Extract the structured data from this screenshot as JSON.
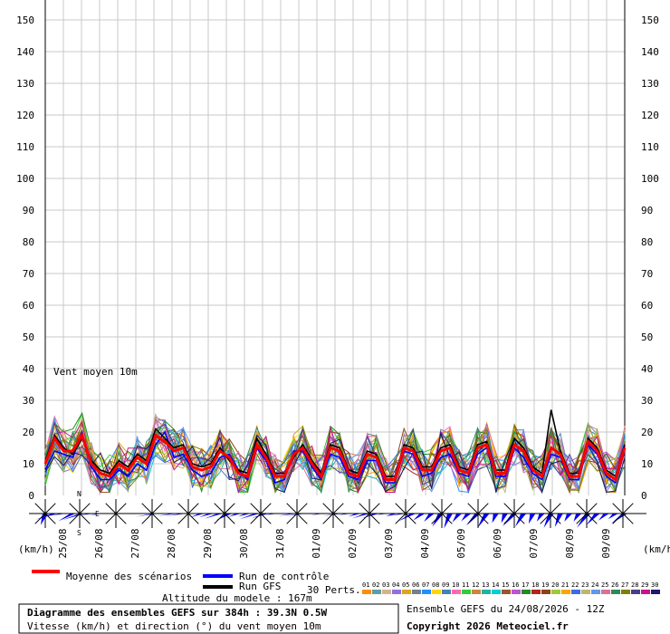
{
  "chart_data": {
    "type": "line",
    "title": "Diagramme des ensembles GEFS sur 384h : 39.3N 0.5W",
    "subtitle": "Vitesse (km/h) et direction (°) du vent moyen 10m",
    "panel_label": "Vent moyen 10m",
    "ylim": [
      0,
      150
    ],
    "yticks": [
      0,
      10,
      20,
      30,
      40,
      50,
      60,
      70,
      80,
      90,
      100,
      110,
      120,
      130,
      140,
      150
    ],
    "x_dates": [
      "25/08",
      "26/08",
      "27/08",
      "28/08",
      "29/08",
      "30/08",
      "31/08",
      "01/09",
      "02/09",
      "03/09",
      "04/09",
      "05/09",
      "06/09",
      "07/09",
      "08/09",
      "09/09"
    ],
    "unit_left": "(km/h)",
    "unit_right": "(km/h)",
    "grid": true,
    "series": [
      {
        "name": "Moyenne des scénarios",
        "color": "#ff0000",
        "values": [
          10,
          18,
          14,
          14,
          19,
          10,
          7,
          6,
          10,
          8,
          12,
          10,
          19,
          17,
          14,
          15,
          9,
          8,
          9,
          14,
          12,
          7,
          6,
          16,
          12,
          6,
          6,
          13,
          15,
          10,
          6,
          15,
          14,
          7,
          6,
          13,
          12,
          5,
          5,
          15,
          14,
          8,
          8,
          14,
          15,
          8,
          7,
          15,
          16,
          7,
          7,
          16,
          14,
          8,
          6,
          15,
          13,
          6,
          6,
          17,
          14,
          7,
          5,
          15
        ]
      },
      {
        "name": "Run de contrôle",
        "color": "#0000ff",
        "values": [
          8,
          14,
          13,
          12,
          20,
          9,
          5,
          5,
          8,
          6,
          10,
          8,
          16,
          20,
          12,
          13,
          8,
          6,
          7,
          12,
          13,
          8,
          5,
          15,
          11,
          4,
          5,
          14,
          14,
          9,
          5,
          13,
          12,
          6,
          5,
          11,
          11,
          4,
          4,
          14,
          13,
          6,
          7,
          12,
          13,
          7,
          6,
          13,
          15,
          6,
          6,
          15,
          12,
          7,
          5,
          13,
          12,
          5,
          5,
          16,
          13,
          6,
          4,
          14
        ]
      },
      {
        "name": "Run GFS",
        "color": "#000000",
        "values": [
          11,
          19,
          15,
          13,
          18,
          11,
          8,
          7,
          11,
          9,
          13,
          11,
          21,
          18,
          15,
          16,
          10,
          9,
          10,
          15,
          11,
          8,
          7,
          18,
          13,
          7,
          7,
          12,
          16,
          11,
          7,
          16,
          15,
          8,
          7,
          14,
          13,
          6,
          6,
          16,
          15,
          9,
          9,
          15,
          16,
          9,
          8,
          16,
          17,
          8,
          8,
          18,
          15,
          9,
          7,
          27,
          14,
          7,
          7,
          18,
          15,
          8,
          6,
          16
        ]
      }
    ],
    "perturbation_count_label": "30 Perts.",
    "perturbation_numbers": [
      "01",
      "02",
      "03",
      "04",
      "05",
      "06",
      "07",
      "08",
      "09",
      "10",
      "11",
      "12",
      "13",
      "14",
      "15",
      "16",
      "17",
      "18",
      "19",
      "20",
      "21",
      "22",
      "23",
      "24",
      "25",
      "26",
      "27",
      "28",
      "29",
      "30"
    ],
    "perturbation_colors": [
      "#ff8c00",
      "#5f9ea0",
      "#d2b48c",
      "#9370db",
      "#daa520",
      "#708090",
      "#1e90ff",
      "#ffd700",
      "#4682b4",
      "#ff69b4",
      "#32cd32",
      "#cd853f",
      "#20b2aa",
      "#00ced1",
      "#a0522d",
      "#ba55d3",
      "#228b22",
      "#b22222",
      "#8b4513",
      "#9acd32",
      "#ffa500",
      "#4169e1",
      "#bdb76b",
      "#6495ed",
      "#db7093",
      "#2e8b57",
      "#808000",
      "#483d8b",
      "#c71585",
      "#191970"
    ],
    "direction_deg": [
      200,
      250,
      260,
      240,
      250,
      260,
      260,
      270,
      270,
      270,
      270,
      270,
      260,
      270,
      260,
      260,
      270,
      250,
      250,
      250,
      240,
      250,
      250,
      250,
      250,
      260,
      270,
      260,
      260,
      270,
      260,
      270,
      260,
      260,
      250,
      250,
      250,
      260,
      250,
      260,
      240,
      230,
      220,
      210,
      200,
      215,
      220,
      220,
      210,
      200,
      200,
      220,
      210,
      200,
      210,
      205,
      200,
      210,
      210,
      215,
      220,
      225,
      230,
      230
    ]
  },
  "legend": {
    "mean": "Moyenne des scénarios",
    "control": "Run de contrôle",
    "gfs": "Run GFS",
    "altitude": "Altitude du modele : 167m"
  },
  "compass": {
    "n": "N",
    "s": "S",
    "e": "E"
  },
  "footer": {
    "ensemble_run": "Ensemble GEFS du 24/08/2026 - 12Z",
    "copyright": "Copyright 2026 Meteociel.fr"
  }
}
